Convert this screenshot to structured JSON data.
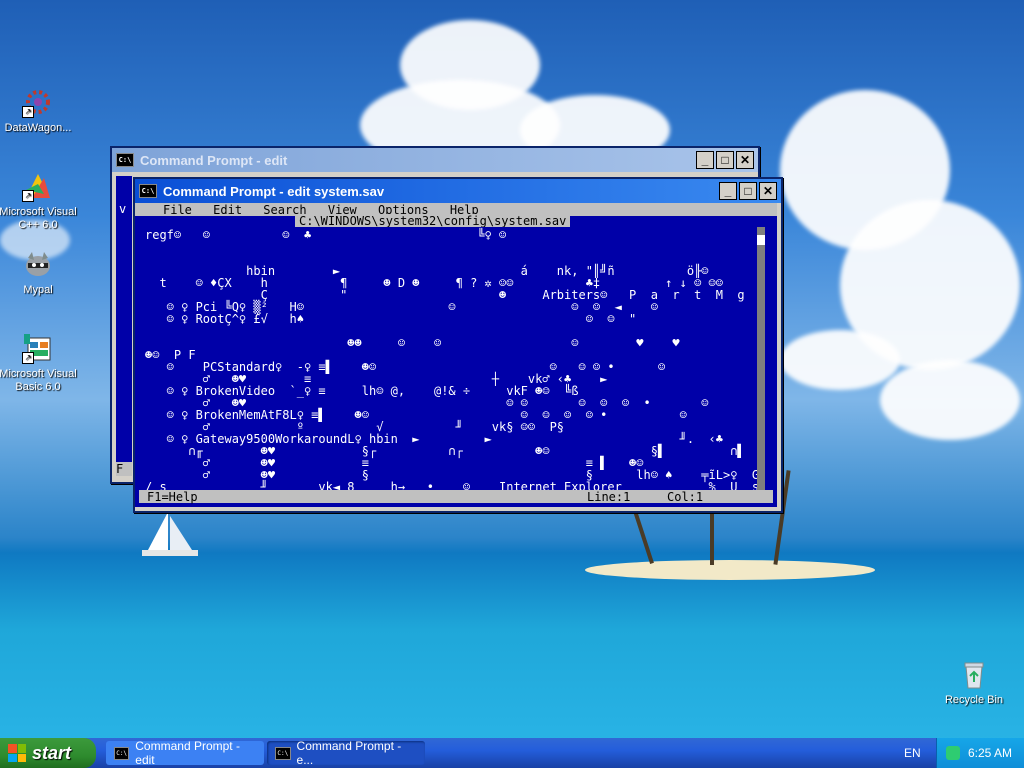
{
  "desktop": {
    "icons": [
      {
        "label": "DataWagon..."
      },
      {
        "label": "Microsoft Visual C++ 6.0"
      },
      {
        "label": "Mypal"
      },
      {
        "label": "Microsoft Visual Basic 6.0"
      },
      {
        "label": "Recycle Bin"
      }
    ]
  },
  "windows": {
    "back": {
      "title": "Command Prompt - edit",
      "side_left_1": "v",
      "side_left_2": "F"
    },
    "front": {
      "title": "Command Prompt - edit system.sav",
      "menu": [
        "File",
        "Edit",
        "Search",
        "View",
        "Options",
        "Help"
      ],
      "path": "C:\\WINDOWS\\system32\\config\\system.sav",
      "content": "regf☺   ☺          ☺  ♣                       ╚♀ ☺\n\n\n              hbin        ►                         á    nk, \"║╝ñ          ö╟☺          ☻\n  t    ☺ ♦ÇX    h          ¶     ☻ D ☻     ¶ ? ✲ ☺☺          ♣‡         ↑ ↓ ☺ ☺☺       ♣           ♠\n                Ç          \"                     ☻     Arbiters☺   P  a  r  t  M  g  r\n   ☺ ♀ Pci ╚Q♀ ▒²   H☺                    ☺                ☺  ☺  ◄    ☺                        ☺\n   ☺ ♀ RootÇ^♀ £√   h♠                                       ☺  ☺  \"                            ♣\n\n                            ☻☻     ☺    ☺                  ☺        ♥    ♥\n☻☺  P F\n   ☺    PCStandard♀  -♀ ≡▌    ☻☺                        ☺   ☺ ☺ •      ☺\n        ♂   ☻♥        ≡                         ┼    vk♂ ‹♣    ►\n   ☺ ♀ BrokenVideo  `_♀ ≡     lh☺ @,    @!& ÷     vkF ☻☺  ╚ß\n        ♂   ☻♥                                    ☺ ☺       ☺  ☺  ☺  •       ☺\n   ☺ ♀ BrokenMemAtF8L♀ ≡▌    ☻☺                     ☺  ☺  ☺  ☺ •          ☺\n        ♂            º          √          ╜    vk§ ☺☺  P§\n   ☺ ♀ Gateway9500WorkaroundL♀ hbin  ►         ►                          ╜.  ‹♣\n      ∩╓        ☻♥            §┌          ∩┌          ☻☺              §▌         ∩▌\n        ♂       ☻♥            ≡                              ≡ ▌   ☻☺\n        ♂       ☻♥            §                              §      lh☺ ♠    ╤ĩL>♀  G(÷÷α   v\n/ s             ╜       vk◄ 8     h→   •    ☺    Internet Explorer            %  U  s  e  r  P ↓",
      "status_help": "F1=Help",
      "status_line": "Line:1",
      "status_col": "Col:1"
    }
  },
  "taskbar": {
    "start_label": "start",
    "tasks": [
      {
        "label": "Command Prompt - edit"
      },
      {
        "label": "Command Prompt - e..."
      }
    ],
    "lang": "EN",
    "clock": "6:25 AM"
  }
}
